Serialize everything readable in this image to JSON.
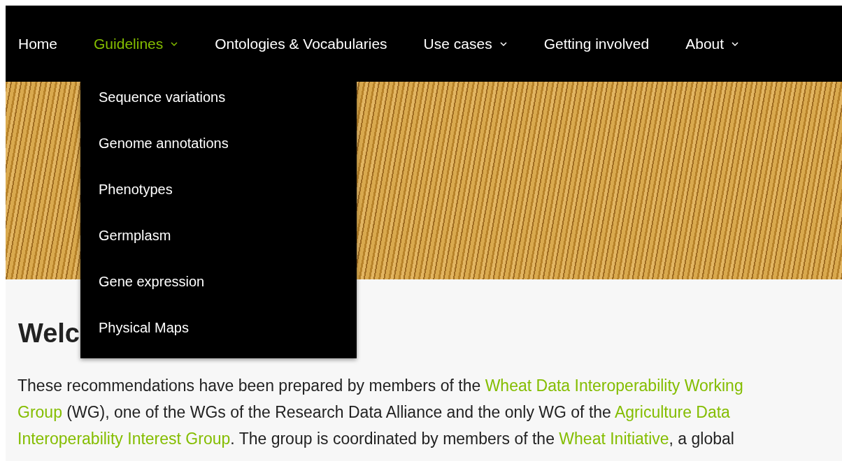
{
  "nav": {
    "items": [
      {
        "label": "Home",
        "selected": false,
        "has_menu": false
      },
      {
        "label": "Guidelines",
        "selected": true,
        "has_menu": true
      },
      {
        "label": "Ontologies & Vocabularies",
        "selected": false,
        "has_menu": false
      },
      {
        "label": "Use cases",
        "selected": false,
        "has_menu": true
      },
      {
        "label": "Getting involved",
        "selected": false,
        "has_menu": false
      },
      {
        "label": "About",
        "selected": false,
        "has_menu": true
      }
    ]
  },
  "dropdown": {
    "items": [
      "Sequence variations",
      "Genome annotations",
      "Phenotypes",
      "Germplasm",
      "Gene expression",
      "Physical Maps"
    ]
  },
  "heading": "Welc",
  "paragraph": {
    "lines": [
      [
        {
          "kind": "text",
          "text": "These recommendations have been prepared by members of the "
        },
        {
          "kind": "link",
          "text": "Wheat Data Interoperability Working"
        }
      ],
      [
        {
          "kind": "link",
          "text": "Group"
        },
        {
          "kind": "text",
          "text": " (WG), one of the WGs of the Research Data Alliance and the only WG of the "
        },
        {
          "kind": "link",
          "text": "Agriculture Data"
        }
      ],
      [
        {
          "kind": "link",
          "text": "Interoperability Interest Group"
        },
        {
          "kind": "text",
          "text": ". The group is coordinated by members of the "
        },
        {
          "kind": "link",
          "text": "Wheat Initiative"
        },
        {
          "kind": "text",
          "text": ", a global"
        }
      ]
    ]
  }
}
